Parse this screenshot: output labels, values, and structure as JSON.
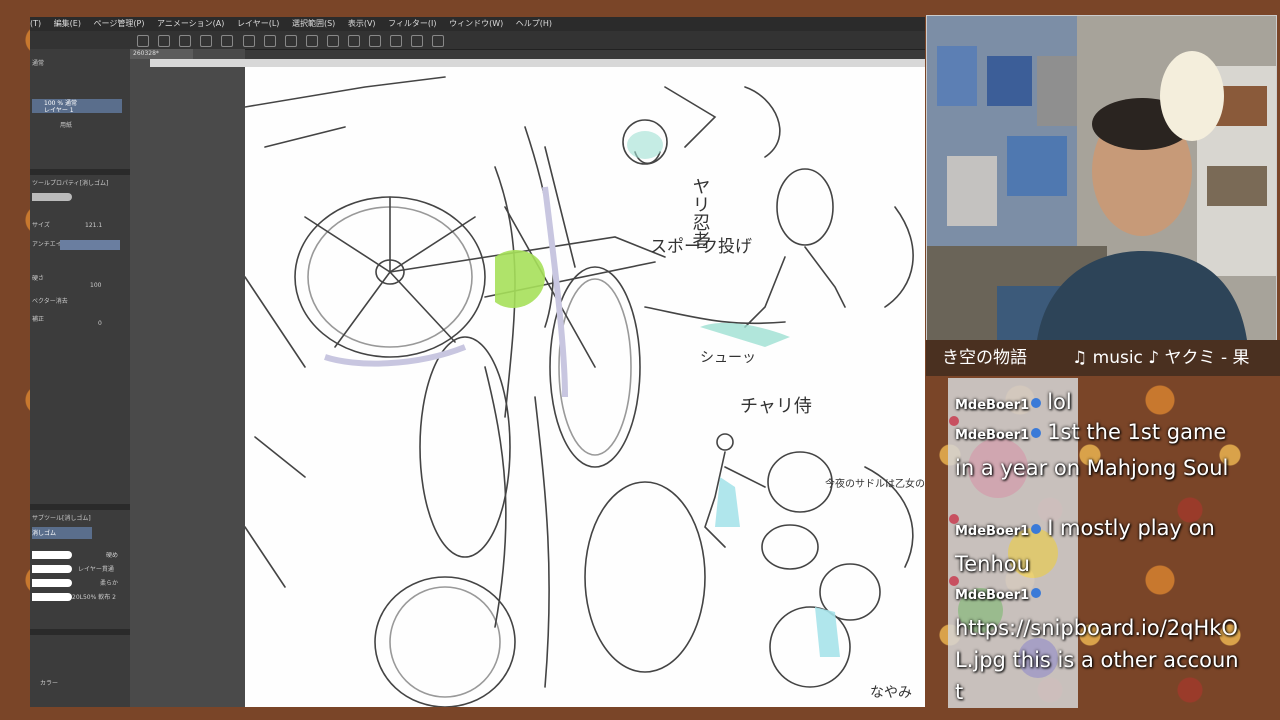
{
  "app": {
    "menu": [
      "(T)",
      "編集(E)",
      "ページ管理(P)",
      "アニメーション(A)",
      "レイヤー(L)",
      "選択範囲(S)",
      "表示(V)",
      "フィルター(I)",
      "ウィンドウ(W)",
      "ヘルプ(H)"
    ],
    "doc_tab": "260328*",
    "left_panel": {
      "layer_mode": "通常",
      "layer_item_1": "100 % 通常",
      "layer_item_1_sub": "レイヤー 1",
      "layer_item_2": "用紙",
      "tool_property": "ツールプロパティ[消しゴム]",
      "size_label": "サイズ",
      "size_value": "121.1",
      "antialias_label": "アンチエイリアス",
      "hardness_label": "硬さ",
      "hardness_value": "100",
      "erase_label": "ベクター消去",
      "correction_label": "補正",
      "correction_value": "0",
      "subtool_label": "サブツール[消しゴム]",
      "subtool_header": "消しゴム",
      "subtool_items": [
        "硬め",
        "レイヤー貫通",
        "柔らか",
        "20L50% 軟布 2"
      ],
      "color_label": "カラー"
    }
  },
  "sketch_texts": [
    "ヤリ忍者",
    "スポーク投げ",
    "シューッ",
    "チャリ侍",
    "今夜のサドルは乙女の尻を欲しがっておるわ",
    "なやみ"
  ],
  "music": {
    "left_text": "き空の物語",
    "right_text": "♫ music ♪ ヤクミ - 果"
  },
  "chat": [
    {
      "user": "MdeBoer1",
      "text": "lol"
    },
    {
      "user": "MdeBoer1",
      "text": "1st the 1st game in a year on Mahjong Soul"
    },
    {
      "user": "MdeBoer1",
      "text": "I mostly play on Tenhou"
    },
    {
      "user": "MdeBoer1",
      "text": "https://snipboard.io/2qHkOL.jpg this is a other account"
    }
  ],
  "colors": {
    "accent": "#5a6e8c",
    "chat_bullet": "#c85060",
    "badge": "#3a7ad8"
  }
}
